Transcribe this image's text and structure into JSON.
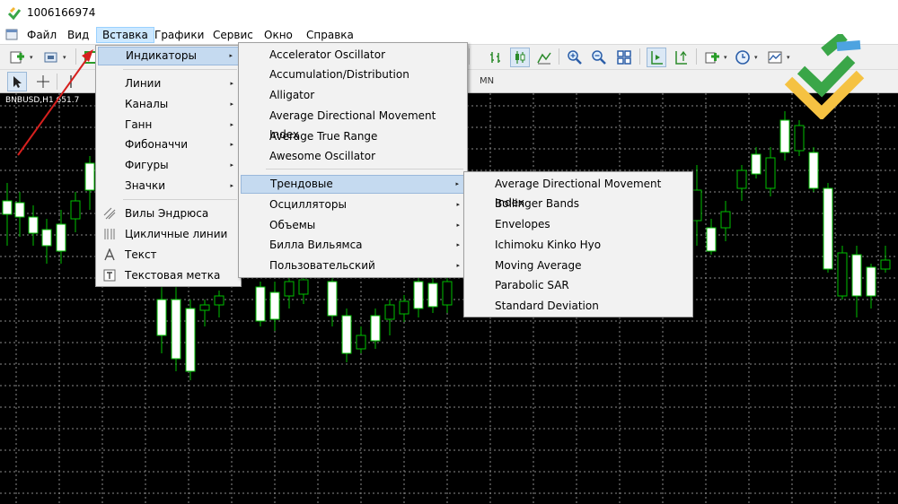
{
  "window": {
    "title": "1006166974"
  },
  "menubar": {
    "items": [
      {
        "label": "Файл"
      },
      {
        "label": "Вид"
      },
      {
        "label": "Вставка"
      },
      {
        "label": "Графики"
      },
      {
        "label": "Сервис"
      },
      {
        "label": "Окно"
      },
      {
        "label": "Справка"
      }
    ],
    "active": "Вставка"
  },
  "toolbar2": {
    "timeframe_label": "MN"
  },
  "chart": {
    "symbol": "BNBUSD,H1  651.7",
    "candle_up_color": "#ffffff",
    "candle_line_color": "#00c000",
    "grid_color": "#8a8a8a",
    "background": "#000000"
  },
  "insert_menu": {
    "items": [
      {
        "label": "Индикаторы",
        "submenu": true,
        "highlighted": true
      },
      {
        "label": "Линии",
        "submenu": true
      },
      {
        "label": "Каналы",
        "submenu": true
      },
      {
        "label": "Ганн",
        "submenu": true
      },
      {
        "label": "Фибоначчи",
        "submenu": true
      },
      {
        "label": "Фигуры",
        "submenu": true
      },
      {
        "label": "Значки",
        "submenu": true
      },
      {
        "label": "Вилы Эндрюса",
        "icon": "andrews-pitchfork-icon"
      },
      {
        "label": "Цикличные линии",
        "icon": "cycle-lines-icon"
      },
      {
        "label": "Текст",
        "icon": "text-icon"
      },
      {
        "label": "Текстовая метка",
        "icon": "text-label-icon"
      }
    ]
  },
  "indicators_menu": {
    "items": [
      {
        "label": "Accelerator Oscillator"
      },
      {
        "label": "Accumulation/Distribution"
      },
      {
        "label": "Alligator"
      },
      {
        "label": "Average Directional Movement Index"
      },
      {
        "label": "Average True Range"
      },
      {
        "label": "Awesome Oscillator"
      },
      {
        "label": "Трендовые",
        "submenu": true,
        "highlighted": true
      },
      {
        "label": "Осцилляторы",
        "submenu": true
      },
      {
        "label": "Объемы",
        "submenu": true
      },
      {
        "label": "Билла Вильямса",
        "submenu": true
      },
      {
        "label": "Пользовательский",
        "submenu": true
      }
    ]
  },
  "trend_menu": {
    "items": [
      {
        "label": "Average Directional Movement Index"
      },
      {
        "label": "Bollinger Bands"
      },
      {
        "label": "Envelopes"
      },
      {
        "label": "Ichimoku Kinko Hyo"
      },
      {
        "label": "Moving Average"
      },
      {
        "label": "Parabolic SAR"
      },
      {
        "label": "Standard Deviation"
      }
    ]
  },
  "icons": {
    "submenu_arrow": "▸",
    "caret": "▾"
  }
}
